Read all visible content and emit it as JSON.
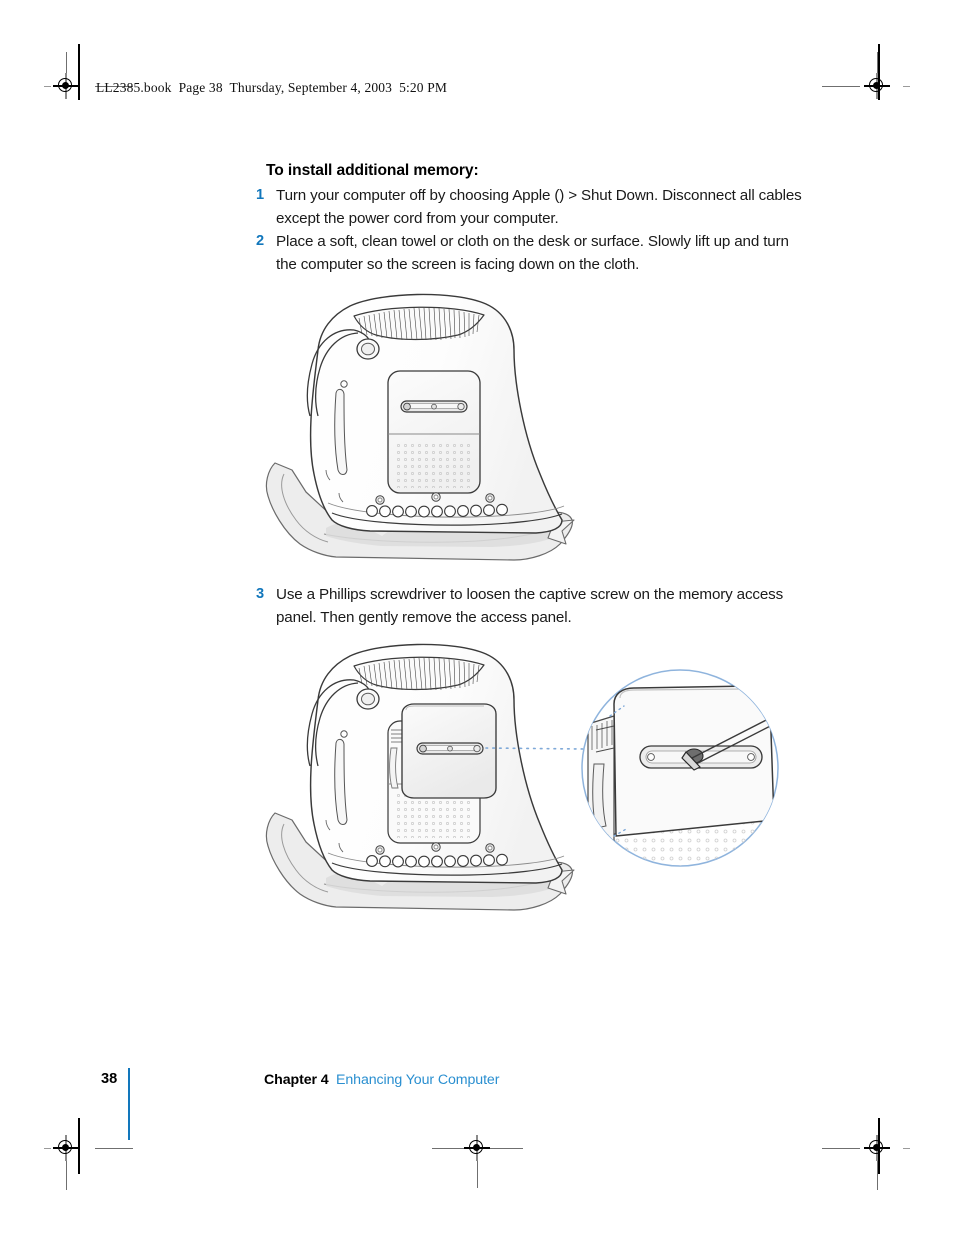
{
  "page": {
    "running_head": "LL2385.book  Page 38  Thursday, September 4, 2003  5:20 PM",
    "heading": "To install additional memory:",
    "accent_blue": "#1277bc",
    "footer_link_blue": "#2a8fd0"
  },
  "steps": [
    {
      "number": "1",
      "text_before_glyph": "Turn your computer off by choosing Apple (",
      "glyph": "",
      "glyph_name": "apple-logo-glyph",
      "text_after_glyph": ") > Shut Down. Disconnect all cables except the power cord from your computer."
    },
    {
      "number": "2",
      "text": "Place a soft, clean towel or cloth on the desk or surface. Slowly lift up and turn the computer so the screen is facing down on the cloth."
    },
    {
      "number": "3",
      "text": "Use a Phillips screwdriver to loosen the captive screw on the memory access panel. Then gently remove the access panel."
    }
  ],
  "figures": [
    {
      "name": "imac-base-upside-down-on-cloth",
      "caption": "",
      "description": "Computer dome base turned upside down on a folded cloth, showing vent grille, power cord, memory access panel with captive screw, and port row"
    },
    {
      "name": "imac-access-panel-removal-with-callout",
      "caption": "",
      "description": "Same dome with access panel lifted, plus a circular magnified callout showing a Phillips screwdriver loosening the captive screw"
    }
  ],
  "footer": {
    "page_number": "38",
    "chapter_label": "Chapter 4",
    "chapter_title": "Enhancing Your Computer"
  }
}
